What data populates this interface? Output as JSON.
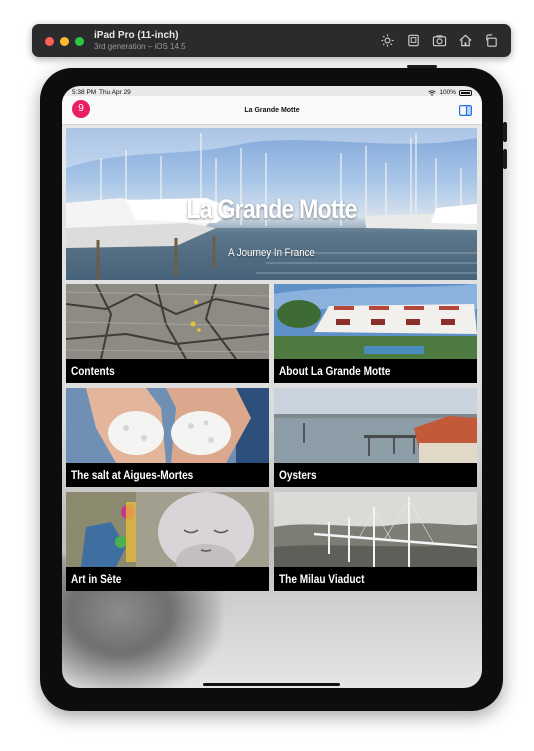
{
  "simulator": {
    "device_name": "iPad Pro (11-inch)",
    "device_info": "3rd generation – iOS 14.5",
    "toolbar_icons": [
      "brightness-icon",
      "screenshot-icon",
      "camera-icon",
      "home-icon",
      "rotate-icon"
    ]
  },
  "status_bar": {
    "time": "5:38 PM",
    "date": "Thu Apr 29",
    "battery": "100%"
  },
  "navbar": {
    "badge_count": "9",
    "title": "La Grande Motte",
    "badge_color": "#e91e63",
    "accent_color": "#1e73e8"
  },
  "hero": {
    "title": "La Grande Motte",
    "subtitle": "A Journey In France"
  },
  "tiles": [
    {
      "label": "Contents"
    },
    {
      "label": "About La Grande Motte"
    },
    {
      "label": "The salt at Aigues-Mortes"
    },
    {
      "label": "Oysters"
    },
    {
      "label": "Art in Sète"
    },
    {
      "label": "The Milau Viaduct"
    }
  ]
}
